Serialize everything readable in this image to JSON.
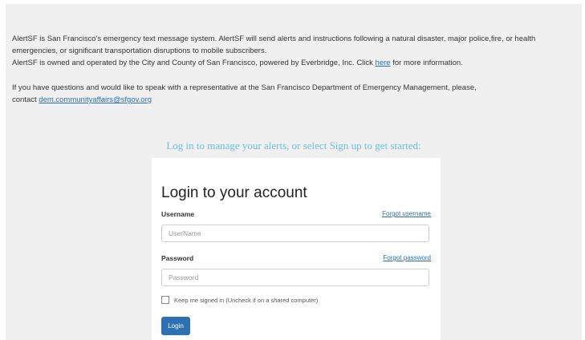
{
  "intro": {
    "p1": "AlertSF is San Francisco's emergency text message system. AlertSF will send alerts and instructions following a natural disaster, major police,fire, or health emergencies, or significant transportation disruptions to mobile subscribers.",
    "p2_before": "AlertSF is owned and operated by the City and County of San Francisco, powered by Everbridge, Inc. Click ",
    "p2_link": "here",
    "p2_after": " for more information.",
    "p3_line1": "If you have questions and would like to speak with a representative at the San Francisco Department of Emergency Management, please,",
    "p3_line2_before": "contact ",
    "p3_email": "dem.communityaffairs@sfgov.org"
  },
  "tagline": "Log in to manage your alerts, or select Sign up to get started:",
  "login": {
    "title": "Login to your account",
    "username_label": "Username",
    "forgot_username": "Forgot username",
    "username_placeholder": "UserName",
    "password_label": "Password",
    "forgot_password": "Forgot password",
    "password_placeholder": "Password",
    "remember_label": "Keep me signed in (Uncheck if on a shared computer)",
    "login_button": "Login"
  }
}
